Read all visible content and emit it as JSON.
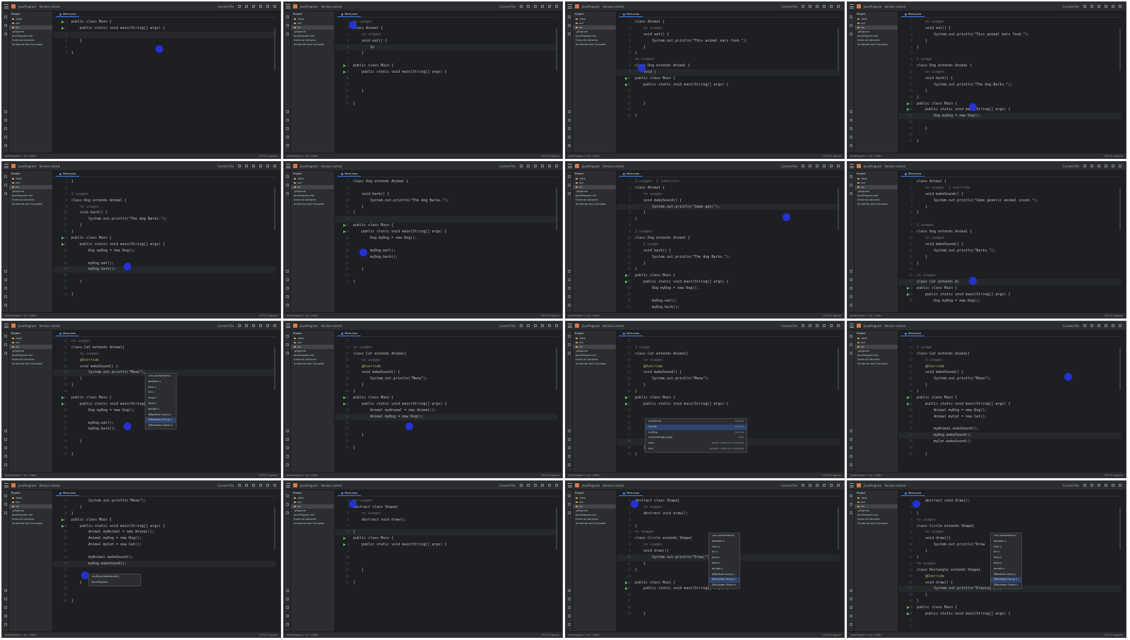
{
  "window": {
    "project_name": "JavaProgram",
    "vcs_label": "Version control",
    "run_config": "Current File",
    "tab_label": "Main.java",
    "project_panel_title": "Project",
    "project_tree": [
      ".idea",
      "out",
      "src",
      ".gitignore",
      "JavaProgram.iml",
      "External Libraries",
      "Scratches and Consoles"
    ],
    "status_path": "JavaProgram > src > Main",
    "status_right": "UTF-8  4 spaces"
  },
  "frames": [
    {
      "first_line": 1,
      "code": [
        "public class Main {",
        "    public static void main(String[] args) {",
        "",
        "    }",
        "",
        "}"
      ],
      "run_rows": [
        0,
        1
      ],
      "current_row": 2,
      "cursor_pos": "mid-right"
    },
    {
      "first_line": 1,
      "code": [
        "no usages",
        "class Animal {",
        "    no usages",
        "    void eat() {",
        "        Sy",
        "    }",
        "",
        "public class Main {",
        "    public static void main(String[] args) {",
        "",
        "",
        "    }",
        "",
        "}"
      ],
      "run_rows": [
        7,
        8
      ],
      "current_row": 4,
      "cursor_pos": "top-left"
    },
    {
      "first_line": 1,
      "code": [
        "class Animal {",
        "    no usages",
        "    void eat() {",
        "        System.out.println(\"This animal eats food.\");",
        "    }",
        "}",
        "no usages",
        "class Dog extends Animal {",
        "    void |",
        "public class Main {",
        "    public static void main(String[] args) {",
        "",
        "",
        "    }",
        "",
        "}"
      ],
      "run_rows": [
        9,
        10
      ],
      "current_row": 8,
      "cursor_pos": "left"
    },
    {
      "first_line": 2,
      "code": [
        "    no usages",
        "    void eat() {",
        "        System.out.println(\"This animal eats food.\");",
        "    }",
        "}",
        "",
        "1 usage",
        "class Dog extends Animal {",
        "    no usages",
        "    void bark() {",
        "        System.out.println(\"The dog Barks.\");",
        "    }",
        "}",
        "public class Main {",
        "    public static void main(String[] args) {",
        "        Dog myDog = new Dog();",
        "",
        "    }",
        "",
        "}"
      ],
      "run_rows": [
        13,
        14
      ],
      "current_row": 15,
      "cursor_pos": "center"
    },
    {
      "first_line": 5,
      "code": [
        "}",
        "",
        "2 usages",
        "class Dog extends Animal {",
        "    no usages",
        "    void bark() {",
        "        System.out.println(\"The dog Barks.\");",
        "    }",
        "}",
        "public class Main {",
        "    public static void main(String[] args) {",
        "        Dog myDog = new Dog();",
        "",
        "        myDog.eat();",
        "        myDog.bark();",
        "",
        "    }",
        "",
        "}"
      ],
      "run_rows": [
        9,
        10
      ],
      "current_row": 14,
      "cursor_pos": "center"
    },
    {
      "first_line": 7,
      "code": [
        "class Dog extends Animal {",
        "",
        "    void bark() {",
        "        System.out.println(\"The dog Barks.\");",
        "    }",
        "}",
        "",
        "public class Main {",
        "    public static void main(String[] args) {",
        "        Dog myDog = new Dog();",
        "",
        "        myDog.eat();",
        "        myDog.bark();",
        "",
        "    }",
        "",
        "}"
      ],
      "run_rows": [
        7,
        8
      ],
      "current_row": 6,
      "cursor_pos": "left-low"
    },
    {
      "first_line": 1,
      "code": [
        "2 usages  1 inheritor",
        "class Animal {",
        "    no usages",
        "    void makeSound() {",
        "        System.out.println(\"Some gen|\");",
        "    }",
        "}",
        "",
        "2 usages",
        "class Dog extends Animal {",
        "    1 usage",
        "    void bark() {",
        "        System.out.println(\"The dog Barks.\");",
        "    }",
        "}",
        "public class Main {",
        "    public static void main(String[] args) {",
        "        Dog myDog = new Dog();",
        "",
        "        myDog.eat();",
        "        myDog.bark();"
      ],
      "run_rows": [
        15,
        16
      ],
      "current_row": 4,
      "cursor_pos": "right"
    },
    {
      "first_line": 1,
      "code": [
        "class Animal {",
        "    no usages  1 override",
        "    void makeSound() {",
        "        System.out.println(\"Some generic animal sound.\");",
        "    }",
        "}",
        "",
        "2 usages",
        "class Dog extends Animal {",
        "    no usages",
        "    void makeSound() {",
        "        System.out.println(\"Barks.\");",
        "    }",
        "}",
        "",
        "no usages",
        "class Cat extends A|",
        "public class Main {",
        "    public static void main(String[] args) {",
        "        Dog myDog = new Dog();"
      ],
      "run_rows": [
        17,
        18
      ],
      "current_row": 16,
      "cursor_pos": "center-low"
    },
    {
      "first_line": 12,
      "code": [
        "no usages",
        "class Cat extends Animal{",
        "    no usages",
        "    @Override",
        "    void makeSound() {",
        "        System.out.println(\"Meow\");",
        "    }",
        "}",
        "",
        "public class Main {",
        "    public static void main(String[] args) {",
        "        Dog myDog = new Dog();",
        "",
        "        myDog.eat();",
        "        myDog.bark();",
        "",
        "    }",
        "",
        "}"
      ],
      "run_rows": [
        9,
        10
      ],
      "current_row": 5,
      "cursor_pos": "center",
      "popup": {
        "kind": "params",
        "rows": [
          "<no parameters>",
          "boolean x",
          "char x",
          "int x",
          "long x",
          "float x",
          "double x",
          "@NotNull char[] x",
          "@Nullable String x",
          "@Nullable Object x"
        ],
        "selected": 8
      }
    },
    {
      "first_line": 12,
      "code": [
        "",
        "no usages",
        "class Cat extends Animal{",
        "    no usages",
        "    @Override",
        "    void makeSound() {",
        "        System.out.println(\"Meow\");",
        "    }",
        "}",
        "public class Main {",
        "    public static void main(String[] args) {",
        "        Animal myAnimal = new Animal();",
        "        Animal myDog = new Dog();",
        "",
        "",
        "    }",
        "",
        "}"
      ],
      "run_rows": [
        9,
        10
      ],
      "current_row": 12,
      "cursor_pos": "center"
    },
    {
      "first_line": 12,
      "code": [
        "",
        "1 usage",
        "class Cat extends Animal{",
        "    no usages",
        "    @Override",
        "    void makeSound() {",
        "        System.out.println(\"Meow\");",
        "    }",
        "}",
        "public class Main {",
        "    public static void main(String[] args) {",
        "",
        "",
        "",
        "",
        "",
        "        |",
        "    }",
        "}"
      ],
      "run_rows": [
        9,
        10
      ],
      "current_row": 16,
      "cursor_pos": "center-low",
      "popup": {
        "kind": "complete",
        "rows": [
          {
            "name": "myAnimal",
            "type": "Animal"
          },
          {
            "name": "myCat",
            "type": "Animal"
          },
          {
            "name": "myDog",
            "type": "Animal"
          },
          {
            "name": "main(String[] args)",
            "type": "void"
          },
          {
            "name": "max",
            "type": "lesser value to a variable"
          },
          {
            "name": "min",
            "type": "greater value to a variable"
          }
        ],
        "selected": 1
      }
    },
    {
      "first_line": 12,
      "code": [
        "",
        "1 usage",
        "class Cat extends Animal{",
        "    3 usages",
        "    @Override",
        "    void makeSound() {",
        "        System.out.println(\"Meow\");",
        "    }",
        "}",
        "public class Main {",
        "    public static void main(String[] args) {",
        "        Animal myDog = new Dog();",
        "        Animal myCat = new Cat();",
        "",
        "        myAnimal.makeSound();",
        "        myDog.makeSound();",
        "        myCat.makeSound();",
        "",
        "    }"
      ],
      "run_rows": [
        9,
        10
      ],
      "current_row": 15,
      "cursor_pos": "right"
    },
    {
      "first_line": 14,
      "code": [
        "        System.out.println(\"Meow\");",
        "    }",
        "}",
        "public class Main {",
        "    public static void main(String[] args) {",
        "        Animal myAnimal = new Animal();",
        "        Animal myDog = new Dog();",
        "        Animal myCat = new Cat();",
        "",
        "        myAnimal.makeSound();",
        "        myDog.makeSound();",
        "",
        "",
        "    }",
        "",
        "",
        "}"
      ],
      "run_rows": [
        3,
        4
      ],
      "current_row": 10,
      "cursor_pos": "left-mid",
      "popup": {
        "kind": "hint",
        "rows": [
          "myDog.makeSound();",
          "JavaProgram"
        ],
        "selected": -1
      }
    },
    {
      "first_line": 1,
      "code": [
        "no usages",
        "abstract class Shape{",
        "    no usages",
        "    abstract void draw();",
        "",
        "}",
        "public class Main {",
        "    public static void main(String[] args) {",
        "",
        "",
        "",
        "    }",
        "",
        "}"
      ],
      "run_rows": [
        6,
        7
      ],
      "current_row": 5,
      "cursor_pos": "top-left"
    },
    {
      "first_line": 1,
      "code": [
        "abstract class Shape{",
        "    no usages",
        "    abstract void draw();",
        "",
        "}",
        "no usages",
        "class Circle extends Shape{",
        "    no usages",
        "    void draw(){",
        "        System.out.println(\"Draw|\");",
        "    }",
        "}",
        "",
        "public class Main {",
        "    public static void main(String[] args) {",
        "",
        "",
        "",
        "    }"
      ],
      "run_rows": [
        13,
        14
      ],
      "current_row": 9,
      "cursor_pos": "top-left",
      "popup": {
        "kind": "params",
        "rows": [
          "<no parameters>",
          "boolean x",
          "char x",
          "int x",
          "long x",
          "float x",
          "double x",
          "@NotNull char[] x",
          "@Nullable String x",
          "@Nullable Object x"
        ],
        "selected": 8
      }
    },
    {
      "first_line": 3,
      "code": [
        "    abstract void draw();",
        "",
        "}",
        "no usages",
        "class Circle extends Shape{",
        "    no usages",
        "    void draw(){",
        "        System.out.println(\"Draw",
        "    }",
        "}",
        "no usages",
        "class Rectangle extends Shape{",
        "    @Override",
        "    void draw() {",
        "        System.out.println(\"Drawing |\");",
        "    }",
        "}",
        "public class Main {",
        "    public static void main(String[] args) {",
        "",
        ""
      ],
      "run_rows": [
        17,
        18
      ],
      "current_row": 14,
      "cursor_pos": "top-left",
      "popup": {
        "kind": "params",
        "rows": [
          "<no parameters>",
          "boolean x",
          "char x",
          "int x",
          "long x",
          "float x",
          "double x",
          "@NotNull char[] x",
          "@Nullable String x",
          "@Nullable Object x"
        ],
        "selected": 8
      }
    }
  ]
}
